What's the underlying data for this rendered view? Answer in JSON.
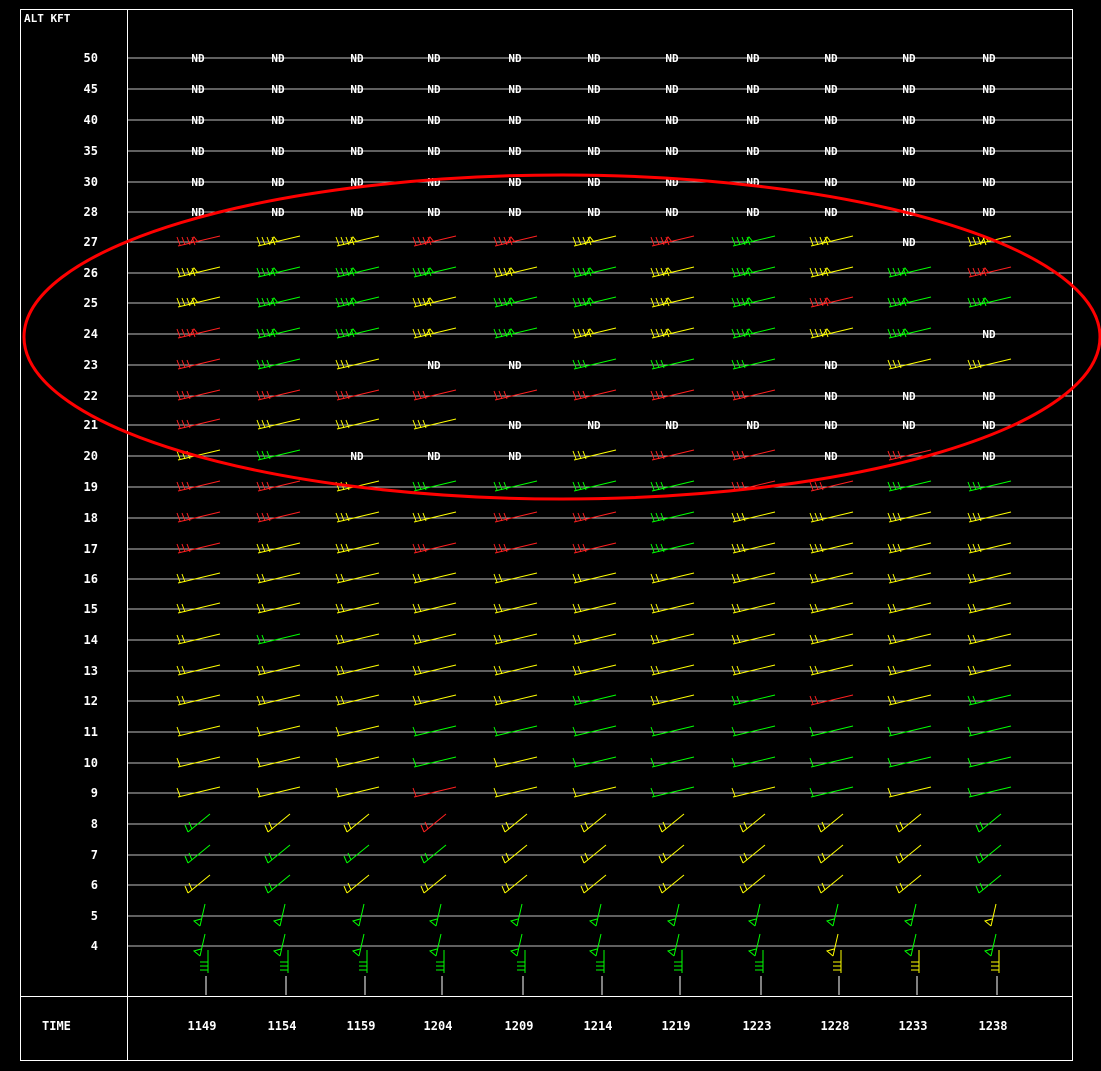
{
  "header": {
    "alt_label": "ALT KFT"
  },
  "footer": {
    "time_label": "TIME"
  },
  "chart_data": {
    "type": "table",
    "ylabel": "ALT KFT",
    "xlabel": "TIME",
    "altitudes": [
      50,
      45,
      40,
      35,
      30,
      28,
      27,
      26,
      25,
      24,
      23,
      22,
      21,
      20,
      19,
      18,
      17,
      16,
      15,
      14,
      13,
      12,
      11,
      10,
      9,
      8,
      7,
      6,
      5,
      4
    ],
    "times": [
      "1149",
      "1154",
      "1159",
      "1204",
      "1209",
      "1214",
      "1219",
      "1223",
      "1228",
      "1233",
      "1238"
    ],
    "missing_label": "ND",
    "colors": {
      "green": "#00ff00",
      "yellow": "#ffff00",
      "red": "#ff2020",
      "white": "#ffffff",
      "highlight": "#ff0000"
    },
    "cell_colors": [
      [
        "w",
        "w",
        "w",
        "w",
        "w",
        "w",
        "w",
        "w",
        "w",
        "w",
        "w"
      ],
      [
        "w",
        "w",
        "w",
        "w",
        "w",
        "w",
        "w",
        "w",
        "w",
        "w",
        "w"
      ],
      [
        "w",
        "w",
        "w",
        "w",
        "w",
        "w",
        "w",
        "w",
        "w",
        "w",
        "w"
      ],
      [
        "w",
        "w",
        "w",
        "w",
        "w",
        "w",
        "w",
        "w",
        "w",
        "w",
        "w"
      ],
      [
        "w",
        "w",
        "w",
        "w",
        "w",
        "w",
        "w",
        "w",
        "w",
        "w",
        "w"
      ],
      [
        "w",
        "w",
        "w",
        "w",
        "w",
        "w",
        "w",
        "w",
        "w",
        "w",
        "w"
      ],
      [
        "r",
        "y",
        "y",
        "r",
        "r",
        "y",
        "r",
        "g",
        "y",
        "w",
        "y"
      ],
      [
        "y",
        "g",
        "g",
        "g",
        "y",
        "g",
        "y",
        "g",
        "y",
        "g",
        "r"
      ],
      [
        "y",
        "g",
        "g",
        "y",
        "g",
        "g",
        "y",
        "g",
        "r",
        "g",
        "g"
      ],
      [
        "r",
        "g",
        "g",
        "y",
        "g",
        "y",
        "y",
        "g",
        "y",
        "g",
        "w"
      ],
      [
        "r",
        "g",
        "y",
        "w",
        "w",
        "g",
        "g",
        "g",
        "w",
        "y",
        "y"
      ],
      [
        "r",
        "r",
        "r",
        "r",
        "r",
        "r",
        "r",
        "r",
        "w",
        "w",
        "w"
      ],
      [
        "r",
        "y",
        "y",
        "y",
        "w",
        "w",
        "w",
        "w",
        "w",
        "w",
        "w"
      ],
      [
        "y",
        "g",
        "w",
        "w",
        "w",
        "y",
        "r",
        "r",
        "w",
        "r",
        "w"
      ],
      [
        "r",
        "r",
        "y",
        "g",
        "g",
        "g",
        "g",
        "r",
        "r",
        "g",
        "g"
      ],
      [
        "r",
        "r",
        "y",
        "y",
        "r",
        "r",
        "g",
        "y",
        "y",
        "y",
        "y"
      ],
      [
        "r",
        "y",
        "y",
        "r",
        "r",
        "r",
        "g",
        "y",
        "y",
        "y",
        "y"
      ],
      [
        "y",
        "y",
        "y",
        "y",
        "y",
        "y",
        "y",
        "y",
        "y",
        "y",
        "y"
      ],
      [
        "y",
        "y",
        "y",
        "y",
        "y",
        "y",
        "y",
        "y",
        "y",
        "y",
        "y"
      ],
      [
        "y",
        "g",
        "y",
        "y",
        "y",
        "y",
        "y",
        "y",
        "y",
        "y",
        "y"
      ],
      [
        "y",
        "y",
        "y",
        "y",
        "y",
        "y",
        "y",
        "y",
        "y",
        "y",
        "y"
      ],
      [
        "y",
        "y",
        "y",
        "y",
        "y",
        "g",
        "y",
        "g",
        "r",
        "y",
        "g"
      ],
      [
        "y",
        "y",
        "y",
        "g",
        "g",
        "g",
        "g",
        "g",
        "g",
        "g",
        "g"
      ],
      [
        "y",
        "y",
        "y",
        "g",
        "y",
        "g",
        "g",
        "g",
        "g",
        "g",
        "g"
      ],
      [
        "y",
        "y",
        "y",
        "r",
        "y",
        "y",
        "g",
        "y",
        "g",
        "y",
        "g"
      ],
      [
        "g",
        "y",
        "y",
        "r",
        "y",
        "y",
        "y",
        "y",
        "y",
        "y",
        "g"
      ],
      [
        "g",
        "g",
        "g",
        "g",
        "y",
        "y",
        "y",
        "y",
        "y",
        "y",
        "g"
      ],
      [
        "y",
        "g",
        "y",
        "y",
        "y",
        "y",
        "y",
        "y",
        "y",
        "y",
        "g"
      ],
      [
        "g",
        "g",
        "g",
        "g",
        "g",
        "g",
        "g",
        "g",
        "g",
        "g",
        "y"
      ],
      [
        "g",
        "g",
        "g",
        "g",
        "g",
        "g",
        "g",
        "g",
        "y",
        "g",
        "g"
      ]
    ],
    "annotation": {
      "shape": "ellipse",
      "color": "red"
    }
  }
}
